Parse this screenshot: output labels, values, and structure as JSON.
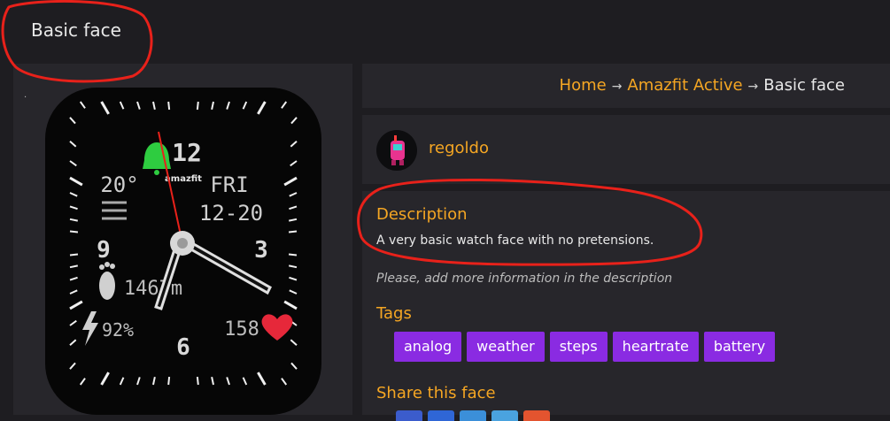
{
  "page": {
    "title": "Basic face"
  },
  "breadcrumb": {
    "home": "Home",
    "category": "Amazfit Active",
    "current": "Basic face",
    "separator": "→"
  },
  "author": {
    "name": "regoldo"
  },
  "description": {
    "heading": "Description",
    "text": "A very basic watch face with no pretensions.",
    "note": "Please, add more information in the description"
  },
  "tags": {
    "heading": "Tags",
    "items": [
      "analog",
      "weather",
      "steps",
      "heartrate",
      "battery"
    ]
  },
  "share": {
    "heading": "Share this face",
    "colors": [
      "#3b5ccc",
      "#2f66d6",
      "#3b8fd9",
      "#4aa3df",
      "#e3542f"
    ]
  },
  "watch": {
    "brand": "amazfit",
    "temperature": "20°",
    "weekday": "FRI",
    "date": "12-20",
    "steps": "1467m",
    "battery": "92%",
    "heart_rate": "158",
    "dial_numbers": {
      "top": "12",
      "right": "3",
      "bottom": "6",
      "left": "9"
    }
  },
  "colors": {
    "accent": "#f5a623",
    "tag": "#8a2be2",
    "annotation": "#e8211a",
    "panel": "#27262b",
    "background": "#1e1d21"
  }
}
